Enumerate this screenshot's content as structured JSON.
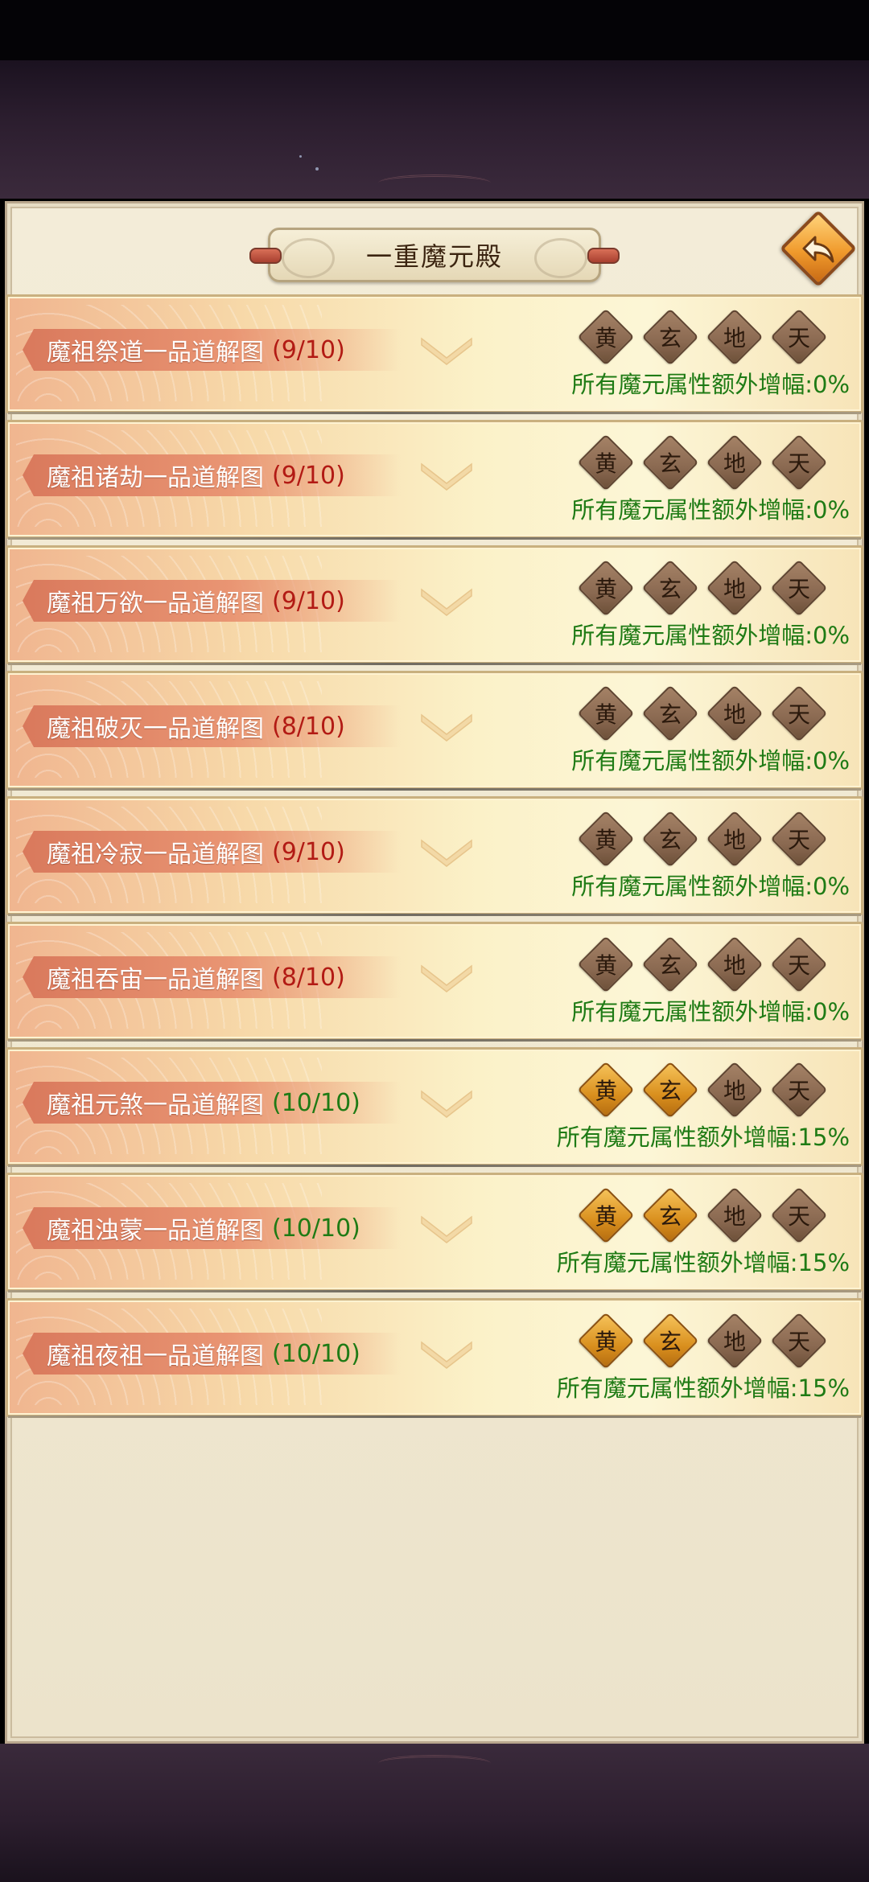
{
  "header": {
    "title": "一重魔元殿"
  },
  "ranks": [
    "黄",
    "玄",
    "地",
    "天"
  ],
  "rows": [
    {
      "name": "魔祖祭道一品道解图",
      "progress": "(9/10)",
      "complete": false,
      "lit": 0,
      "bonus": "所有魔元属性额外增幅:0%"
    },
    {
      "name": "魔祖诸劫一品道解图",
      "progress": "(9/10)",
      "complete": false,
      "lit": 0,
      "bonus": "所有魔元属性额外增幅:0%"
    },
    {
      "name": "魔祖万欲一品道解图",
      "progress": "(9/10)",
      "complete": false,
      "lit": 0,
      "bonus": "所有魔元属性额外增幅:0%"
    },
    {
      "name": "魔祖破灭一品道解图",
      "progress": "(8/10)",
      "complete": false,
      "lit": 0,
      "bonus": "所有魔元属性额外增幅:0%"
    },
    {
      "name": "魔祖冷寂一品道解图",
      "progress": "(9/10)",
      "complete": false,
      "lit": 0,
      "bonus": "所有魔元属性额外增幅:0%"
    },
    {
      "name": "魔祖吞宙一品道解图",
      "progress": "(8/10)",
      "complete": false,
      "lit": 0,
      "bonus": "所有魔元属性额外增幅:0%"
    },
    {
      "name": "魔祖元煞一品道解图",
      "progress": "(10/10)",
      "complete": true,
      "lit": 2,
      "bonus": "所有魔元属性额外增幅:15%"
    },
    {
      "name": "魔祖浊蒙一品道解图",
      "progress": "(10/10)",
      "complete": true,
      "lit": 2,
      "bonus": "所有魔元属性额外增幅:15%"
    },
    {
      "name": "魔祖夜祖一品道解图",
      "progress": "(10/10)",
      "complete": true,
      "lit": 2,
      "bonus": "所有魔元属性额外增幅:15%"
    }
  ],
  "colors": {
    "incomplete": "#b21a14",
    "complete": "#1f7b15",
    "rank_lit": "#d98f1e",
    "rank_unlit": "#8a6951"
  },
  "icons": {
    "back": "back-arrow-icon",
    "expand": "chevron-down-icon"
  }
}
